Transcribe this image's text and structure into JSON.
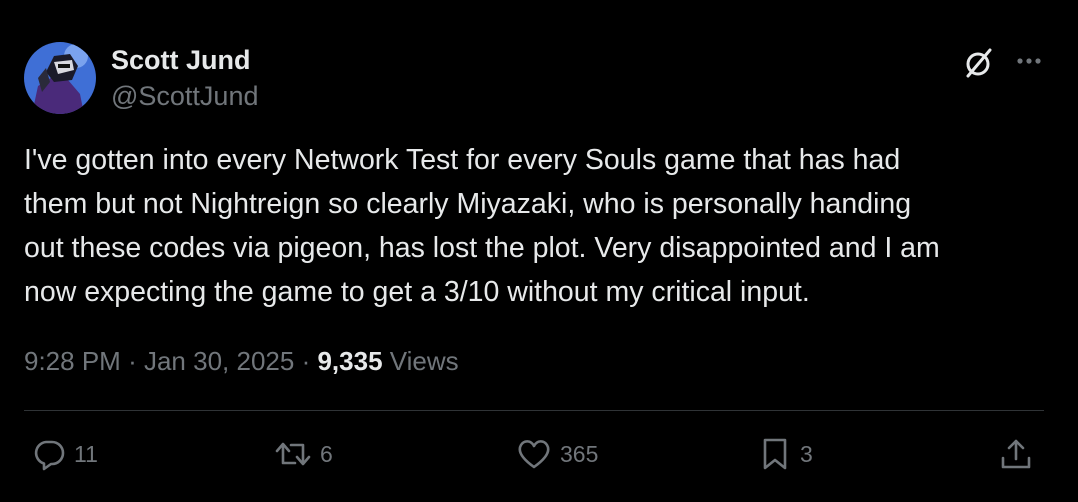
{
  "author": {
    "display_name": "Scott Jund",
    "handle": "@ScottJund",
    "avatar_icon": "user-avatar"
  },
  "header_actions": {
    "grok_icon": "grok-slash-icon",
    "more_icon": "more-dots-icon"
  },
  "tweet": {
    "text_lines": [
      "I've gotten into every Network Test for every Souls game that has had",
      "them but not Nightreign so clearly Miyazaki, who is personally handing",
      "out these codes via pigeon, has lost the plot. Very disappointed and I am",
      "now expecting the game to get a 3/10 without my critical input."
    ]
  },
  "meta": {
    "time": "9:28 PM",
    "separator": "·",
    "date": "Jan 30, 2025",
    "views_count": "9,335",
    "views_label": "Views"
  },
  "actions": {
    "reply": {
      "icon": "reply-icon",
      "count": "11"
    },
    "repost": {
      "icon": "repost-icon",
      "count": "6"
    },
    "like": {
      "icon": "heart-icon",
      "count": "365"
    },
    "bookmark": {
      "icon": "bookmark-icon",
      "count": "3"
    },
    "share": {
      "icon": "share-icon"
    }
  },
  "colors": {
    "background": "#000000",
    "primary_text": "#e7e9ea",
    "secondary_text": "#71767b",
    "divider": "#2f3336"
  }
}
